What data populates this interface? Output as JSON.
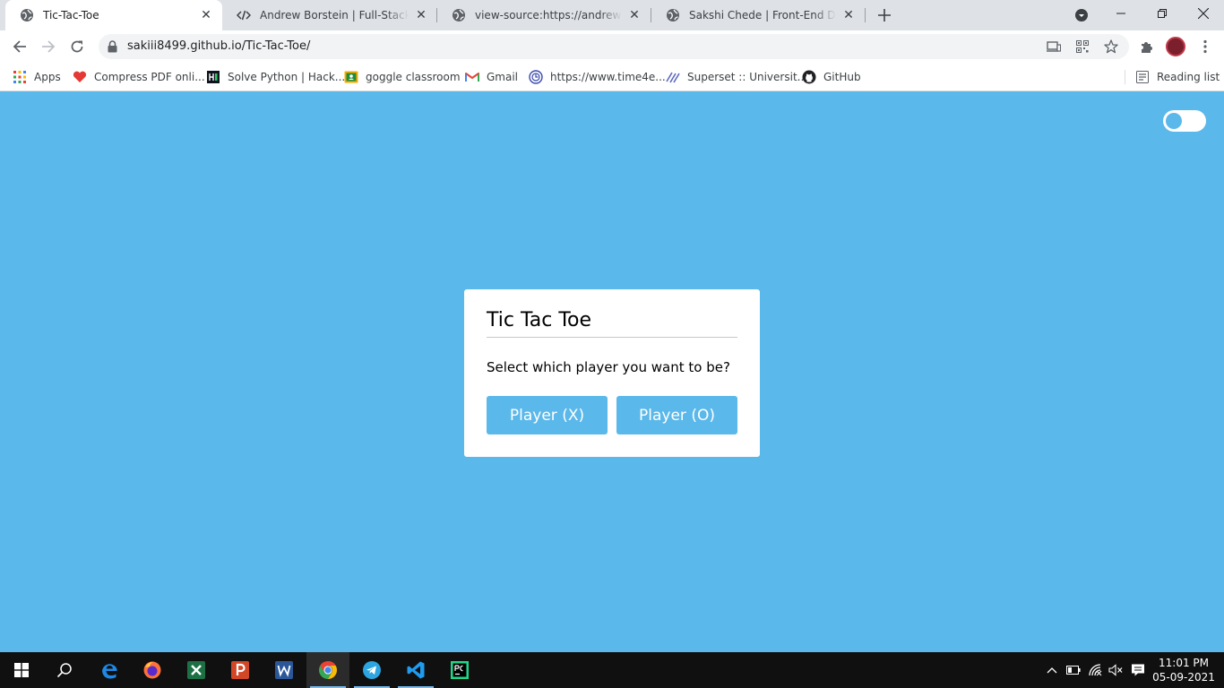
{
  "browser": {
    "tabs": [
      {
        "title": "Tic-Tac-Toe",
        "active": true,
        "icon": "globe-icon"
      },
      {
        "title": "Andrew Borstein | Full-Stack Front",
        "active": false,
        "icon": "code-icon"
      },
      {
        "title": "view-source:https://andrewborstein",
        "active": false,
        "icon": "globe-icon"
      },
      {
        "title": "Sakshi Chede | Front-End Developer",
        "active": false,
        "icon": "globe-icon"
      }
    ],
    "address": "sakiii8499.github.io/Tic-Tac-Toe/",
    "bookmarks": [
      {
        "label": "Apps",
        "icon": "apps-grid-icon"
      },
      {
        "label": "Compress PDF onli...",
        "icon": "heart-pdf-icon"
      },
      {
        "label": "Solve Python | Hack...",
        "icon": "hackerrank-icon"
      },
      {
        "label": "goggle classroom",
        "icon": "classroom-icon"
      },
      {
        "label": "Gmail",
        "icon": "gmail-icon"
      },
      {
        "label": "https://www.time4e...",
        "icon": "time4education-icon"
      },
      {
        "label": "Superset :: Universit...",
        "icon": "superset-icon"
      },
      {
        "label": "GitHub",
        "icon": "github-icon"
      }
    ],
    "reading_list": "Reading list"
  },
  "game": {
    "title": "Tic Tac Toe",
    "prompt": "Select which player you want to be?",
    "player_x": "Player (X)",
    "player_o": "Player (O)",
    "accent_color": "#5bb8ea",
    "theme_toggle_on": false
  },
  "taskbar": {
    "apps": [
      "start-icon",
      "search-icon",
      "edge-icon",
      "firefox-icon",
      "excel-icon",
      "powerpoint-icon",
      "word-icon",
      "chrome-icon",
      "telegram-icon",
      "vscode-icon",
      "pycharm-icon"
    ],
    "active_app": "chrome-icon",
    "time": "11:01 PM",
    "date": "05-09-2021"
  }
}
